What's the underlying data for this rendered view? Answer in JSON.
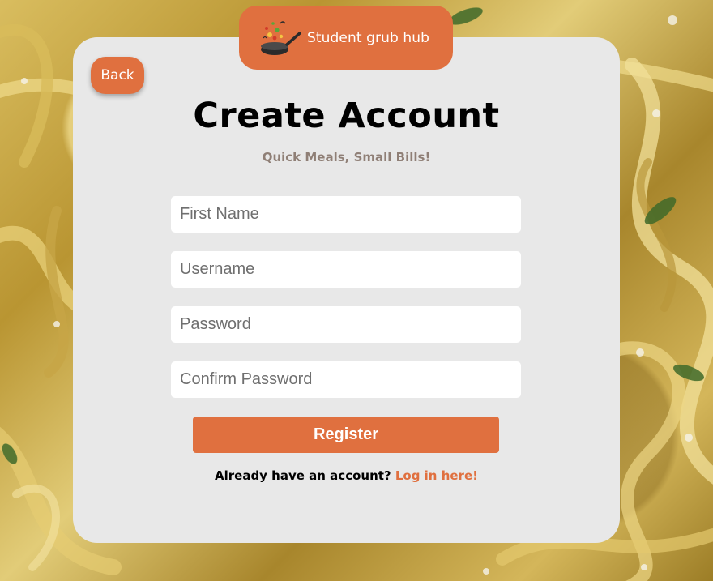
{
  "brand": {
    "name": "Student grub hub",
    "logo_icon": "pan-with-food-icon",
    "accent_color": "#e0703f"
  },
  "back_button": {
    "label": "Back"
  },
  "heading": {
    "title": "Create Account",
    "subtitle": "Quick Meals, Small Bills!"
  },
  "form": {
    "fields": [
      {
        "placeholder": "First Name",
        "value": ""
      },
      {
        "placeholder": "Username",
        "value": ""
      },
      {
        "placeholder": "Password",
        "value": ""
      },
      {
        "placeholder": "Confirm Password",
        "value": ""
      }
    ],
    "submit_label": "Register"
  },
  "footer": {
    "prompt": "Already have an account? ",
    "login_link": "Log in here!"
  },
  "colors": {
    "card": "#e8e8e8",
    "subtitle": "#8f7f76"
  }
}
